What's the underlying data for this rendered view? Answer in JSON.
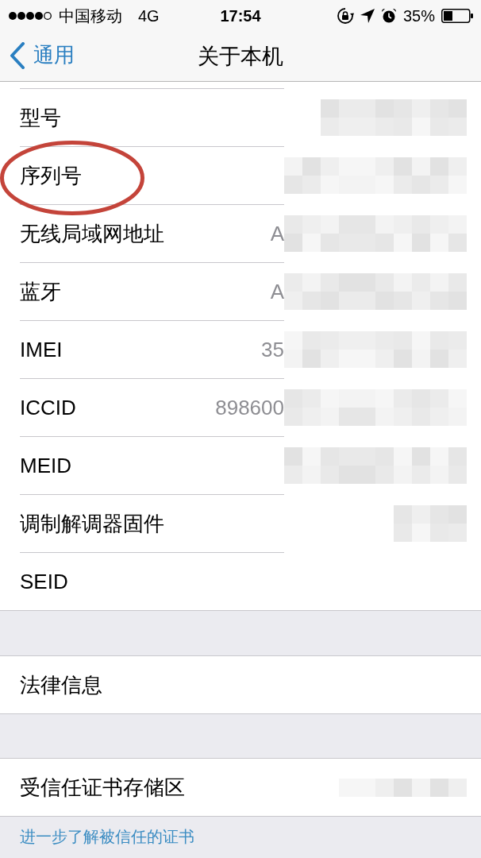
{
  "status_bar": {
    "carrier": "中国移动",
    "network": "4G",
    "time": "17:54",
    "battery": "35%"
  },
  "nav_bar": {
    "back_label": "通用",
    "title": "关于本机"
  },
  "sections": [
    {
      "rows": [
        {
          "label": "型号",
          "circled": false
        },
        {
          "label": "序列号",
          "circled": true
        },
        {
          "label": "无线局域网地址",
          "value": "A",
          "circled": false
        },
        {
          "label": "蓝牙",
          "value": "A",
          "circled": false
        },
        {
          "label": "IMEI",
          "value": "35",
          "circled": false
        },
        {
          "label": "ICCID",
          "value": "898600",
          "circled": false
        },
        {
          "label": "MEID",
          "circled": false
        },
        {
          "label": "调制解调器固件",
          "circled": false
        },
        {
          "label": "SEID",
          "circled": false
        }
      ]
    },
    {
      "rows": [
        {
          "label": "法律信息",
          "circled": false
        }
      ]
    },
    {
      "rows": [
        {
          "label": "受信任证书存储区",
          "circled": false
        }
      ]
    }
  ],
  "footer_link": "进一步了解被信任的证书"
}
